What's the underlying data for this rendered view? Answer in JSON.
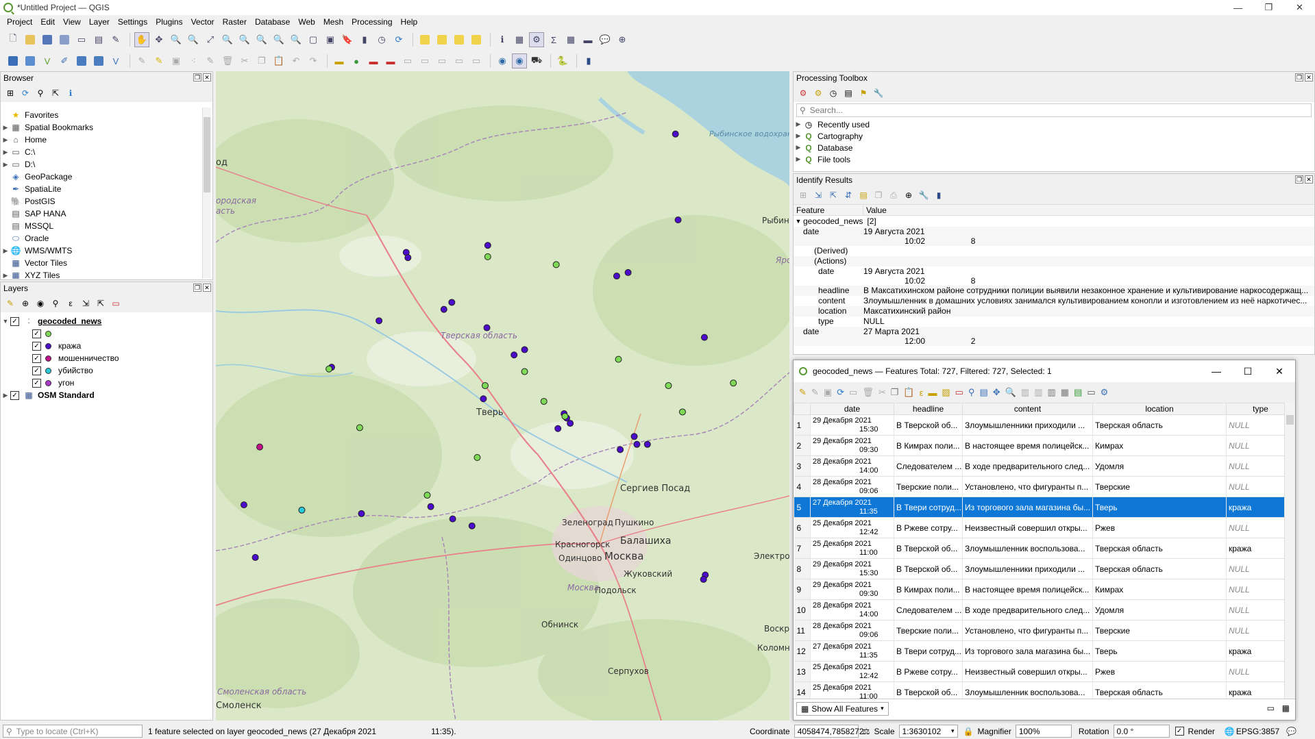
{
  "window": {
    "title": "*Untitled Project — QGIS",
    "minimize": "—",
    "maximize": "❐",
    "close": "✕"
  },
  "menu": [
    "Project",
    "Edit",
    "View",
    "Layer",
    "Settings",
    "Plugins",
    "Vector",
    "Raster",
    "Database",
    "Web",
    "Mesh",
    "Processing",
    "Help"
  ],
  "browser": {
    "title": "Browser",
    "items": [
      {
        "label": "Favorites",
        "icon": "star-icon",
        "arrow": ""
      },
      {
        "label": "Spatial Bookmarks",
        "icon": "bookmark-icon",
        "arrow": "▶"
      },
      {
        "label": "Home",
        "icon": "home-folder-icon",
        "arrow": "▶"
      },
      {
        "label": "C:\\",
        "icon": "drive-icon",
        "arrow": "▶"
      },
      {
        "label": "D:\\",
        "icon": "drive-icon",
        "arrow": "▶"
      },
      {
        "label": "GeoPackage",
        "icon": "geopackage-icon",
        "arrow": ""
      },
      {
        "label": "SpatiaLite",
        "icon": "spatialite-icon",
        "arrow": ""
      },
      {
        "label": "PostGIS",
        "icon": "postgis-icon",
        "arrow": ""
      },
      {
        "label": "SAP HANA",
        "icon": "saphana-icon",
        "arrow": ""
      },
      {
        "label": "MSSQL",
        "icon": "mssql-icon",
        "arrow": ""
      },
      {
        "label": "Oracle",
        "icon": "oracle-icon",
        "arrow": ""
      },
      {
        "label": "WMS/WMTS",
        "icon": "wms-icon",
        "arrow": "▶"
      },
      {
        "label": "Vector Tiles",
        "icon": "vector-tiles-icon",
        "arrow": ""
      },
      {
        "label": "XYZ Tiles",
        "icon": "xyz-tiles-icon",
        "arrow": "▶"
      }
    ]
  },
  "layers": {
    "title": "Layers",
    "group": "geocoded_news",
    "classes": [
      {
        "label": "",
        "color": "#7ed957"
      },
      {
        "label": "кража",
        "color": "#4b0dc9"
      },
      {
        "label": "мошенничество",
        "color": "#c1118a"
      },
      {
        "label": "убийство",
        "color": "#29c8d6"
      },
      {
        "label": "угон",
        "color": "#a838c8"
      }
    ],
    "basemap": "OSM Standard"
  },
  "map": {
    "labels": [
      "Тверская область",
      "Тверь",
      "Рыбинское водохранилище",
      "Сергиев Посад",
      "Зеленоград",
      "Пушкино",
      "Балашиха",
      "Красногорск",
      "Одинцово",
      "Москва",
      "Жуковский",
      "Подольск",
      "Обнинск",
      "Серпухов",
      "Смоленская область",
      "Смоленск",
      "Рыбин",
      "Яро",
      "Электро",
      "Воскресен",
      "Коломн",
      "Москва",
      "ородская",
      "асть",
      "од"
    ]
  },
  "processing": {
    "title": "Processing Toolbox",
    "search_placeholder": "Search...",
    "items": [
      "Recently used",
      "Cartography",
      "Database",
      "File tools"
    ]
  },
  "identify": {
    "title": "Identify Results",
    "col_feature": "Feature",
    "col_value": "Value",
    "layer": "geocoded_news",
    "count": "[2]",
    "rows": [
      {
        "k": "date",
        "v": "19 Августа 2021",
        "v2": "10:02                    8"
      },
      {
        "k": "(Derived)",
        "v": ""
      },
      {
        "k": "(Actions)",
        "v": ""
      },
      {
        "k": "date",
        "v": "19 Августа 2021",
        "v2": "10:02                    8"
      },
      {
        "k": "headline",
        "v": "В Максатихинском районе сотрудники полиции выявили незаконное хранение и культивирование наркосодержащ..."
      },
      {
        "k": "content",
        "v": "Злоумышленник в домашних условиях занимался культивированием конопли и изготовлением из неё наркотичес..."
      },
      {
        "k": "location",
        "v": "Максатихинский район"
      },
      {
        "k": "type",
        "v": "NULL"
      },
      {
        "k": "date",
        "v": "27 Марта 2021",
        "v2": "12:00                    2"
      }
    ]
  },
  "attribute_table": {
    "title": "geocoded_news — Features Total: 727, Filtered: 727, Selected: 1",
    "columns": [
      "date",
      "headline",
      "content",
      "location",
      "type"
    ],
    "rows": [
      {
        "n": "1",
        "d1": "29 Декабря 2021",
        "d2": "15:30",
        "h": "В Тверской об...",
        "c": "Злоумышленники приходили ...",
        "l": "Тверская область",
        "t": "NULL"
      },
      {
        "n": "2",
        "d1": "29 Декабря 2021",
        "d2": "09:30",
        "h": "В Кимрах поли...",
        "c": "В настоящее время полицейск...",
        "l": "Кимрах",
        "t": "NULL"
      },
      {
        "n": "3",
        "d1": "28 Декабря 2021",
        "d2": "14:00",
        "h": "Следователем ...",
        "c": "В ходе предварительного след...",
        "l": "Удомля",
        "t": "NULL"
      },
      {
        "n": "4",
        "d1": "28 Декабря 2021",
        "d2": "09:06",
        "h": "Тверские поли...",
        "c": "Установлено, что фигуранты п...",
        "l": "Тверские",
        "t": "NULL"
      },
      {
        "n": "5",
        "d1": "27 Декабря 2021",
        "d2": "11:35",
        "h": "В Твери сотруд...",
        "c": "Из торгового зала магазина бы...",
        "l": "Тверь",
        "t": "кража",
        "selected": true
      },
      {
        "n": "6",
        "d1": "25 Декабря 2021",
        "d2": "12:42",
        "h": "В Ржеве сотру...",
        "c": "Неизвестный совершил откры...",
        "l": "Ржев",
        "t": "NULL"
      },
      {
        "n": "7",
        "d1": "25 Декабря 2021",
        "d2": "11:00",
        "h": "В Тверской об...",
        "c": "Злоумышленник воспользова...",
        "l": "Тверская область",
        "t": "кража"
      },
      {
        "n": "8",
        "d1": "29 Декабря 2021",
        "d2": "15:30",
        "h": "В Тверской об...",
        "c": "Злоумышленники приходили ...",
        "l": "Тверская область",
        "t": "NULL"
      },
      {
        "n": "9",
        "d1": "29 Декабря 2021",
        "d2": "09:30",
        "h": "В Кимрах поли...",
        "c": "В настоящее время полицейск...",
        "l": "Кимрах",
        "t": "NULL"
      },
      {
        "n": "10",
        "d1": "28 Декабря 2021",
        "d2": "14:00",
        "h": "Следователем ...",
        "c": "В ходе предварительного след...",
        "l": "Удомля",
        "t": "NULL"
      },
      {
        "n": "11",
        "d1": "28 Декабря 2021",
        "d2": "09:06",
        "h": "Тверские поли...",
        "c": "Установлено, что фигуранты п...",
        "l": "Тверские",
        "t": "NULL"
      },
      {
        "n": "12",
        "d1": "27 Декабря 2021",
        "d2": "11:35",
        "h": "В Твери сотруд...",
        "c": "Из торгового зала магазина бы...",
        "l": "Тверь",
        "t": "кража"
      },
      {
        "n": "13",
        "d1": "25 Декабря 2021",
        "d2": "12:42",
        "h": "В Ржеве сотру...",
        "c": "Неизвестный совершил откры...",
        "l": "Ржев",
        "t": "NULL"
      },
      {
        "n": "14",
        "d1": "25 Декабря 2021",
        "d2": "11:00",
        "h": "В Тверской об...",
        "c": "Злоумышленник воспользова...",
        "l": "Тверская область",
        "t": "кража"
      }
    ],
    "show_all": "Show All Features"
  },
  "status": {
    "locate_placeholder": "Type to locate (Ctrl+K)",
    "message": "1 feature selected on layer geocoded_news (27 Декабря 2021                        11:35).",
    "coordinate_label": "Coordinate",
    "coordinate": "4058474,7858272",
    "scale_label": "Scale",
    "scale": "1:3630102",
    "magnifier_label": "Magnifier",
    "magnifier": "100%",
    "rotation_label": "Rotation",
    "rotation": "0.0 °",
    "render_label": "Render",
    "crs": "EPSG:3857"
  },
  "colors": {
    "selection": "#0f78d7",
    "qgis_green": "#589632"
  }
}
